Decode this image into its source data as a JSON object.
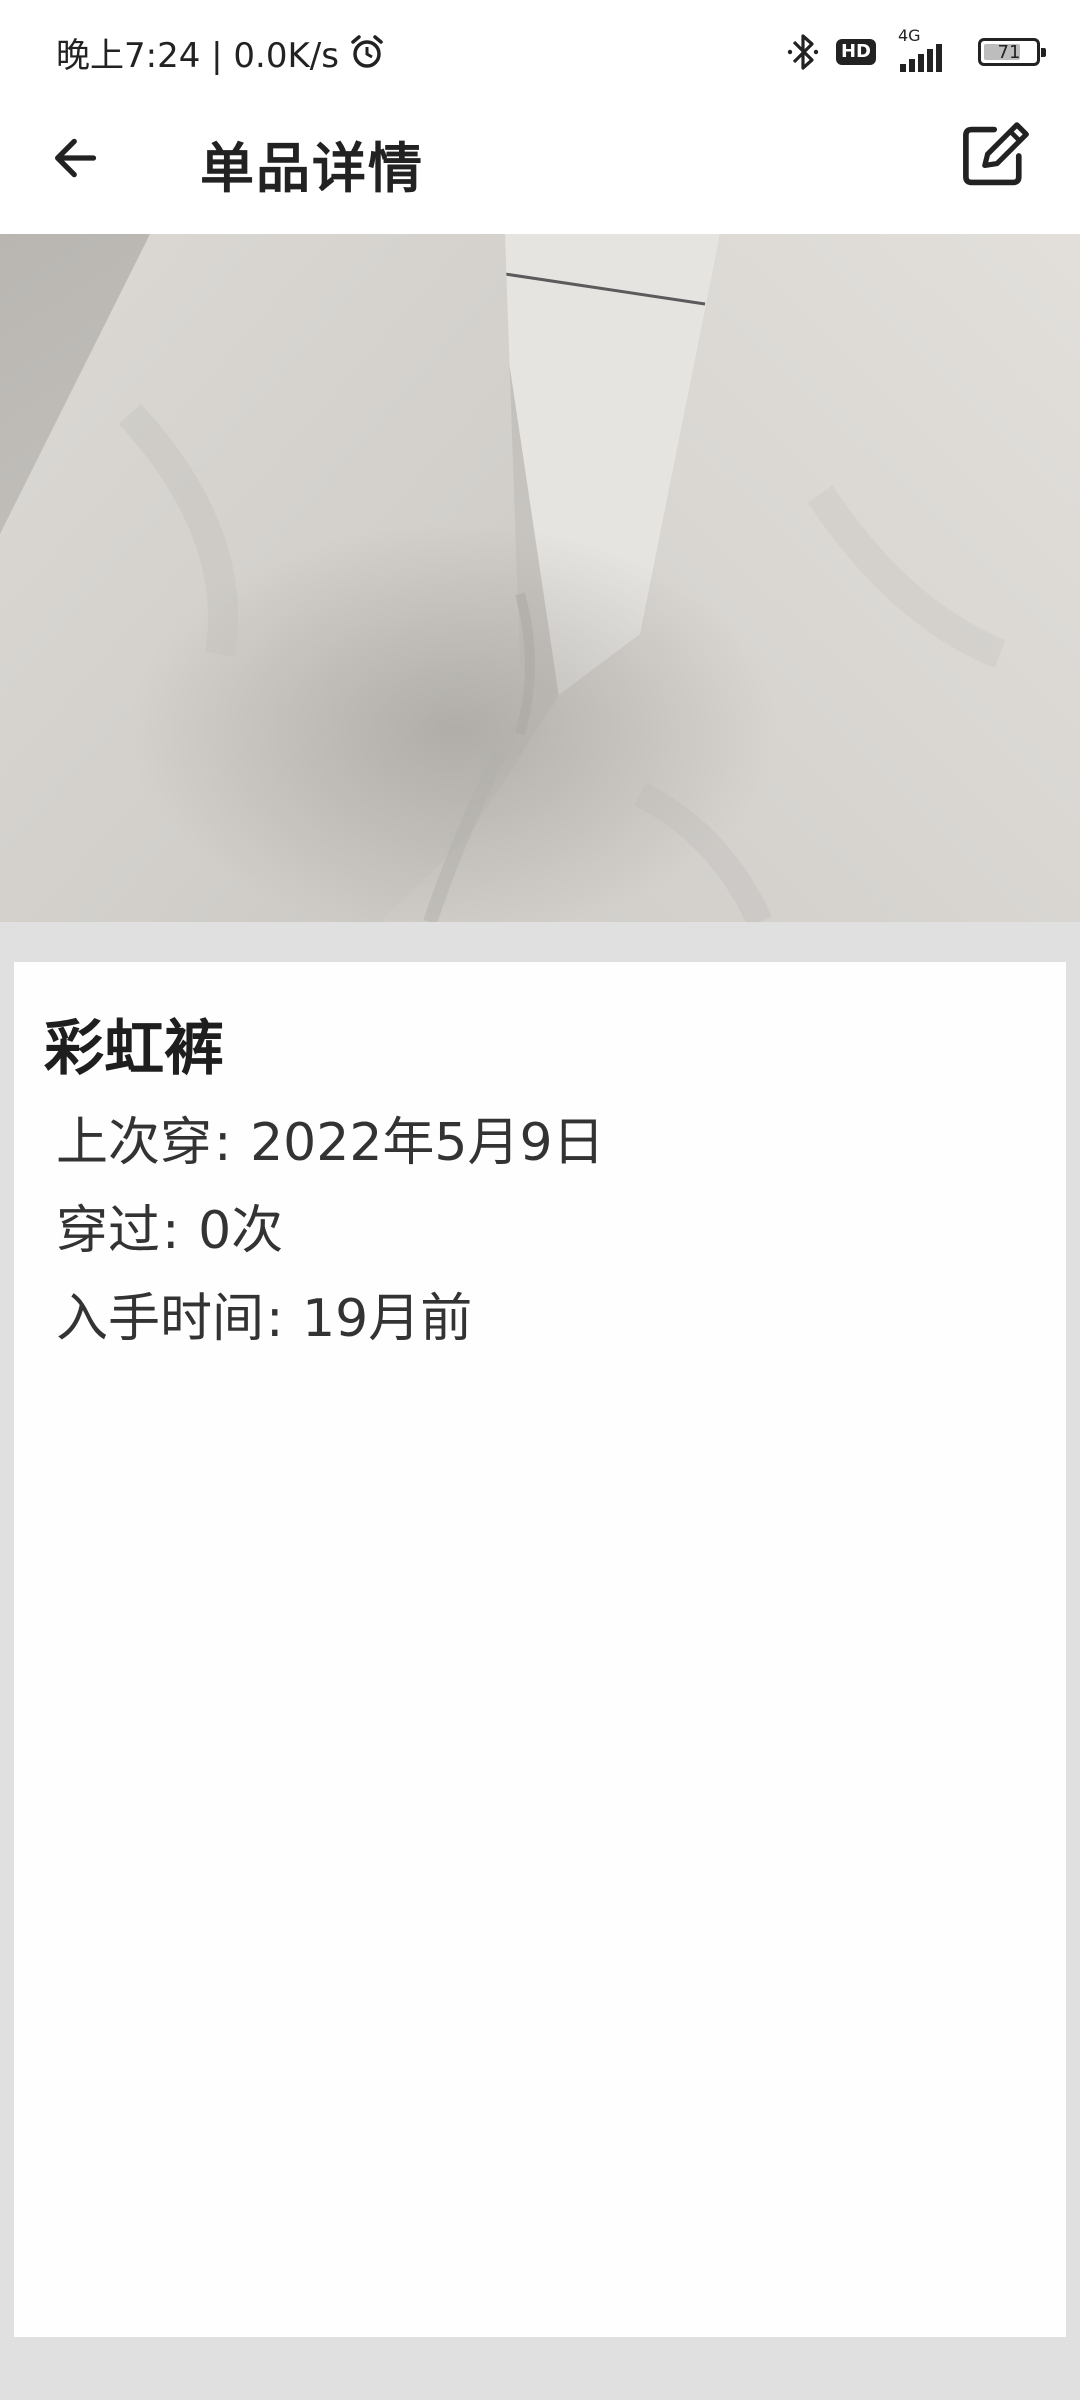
{
  "status_bar": {
    "time_speed": "晚上7:24 | 0.0K/s",
    "hd": "HD",
    "network_type": "4G",
    "battery_level": 71,
    "battery_text": "71"
  },
  "app_bar": {
    "title": "单品详情"
  },
  "item": {
    "name": "彩虹裤",
    "last_worn_label": "上次穿",
    "last_worn_value": "2022年5月9日",
    "times_worn_label": "穿过",
    "times_worn_value": "0次",
    "acquired_label": "入手时间",
    "acquired_value": "19月前"
  },
  "icons": {
    "back": "arrow-left",
    "edit": "edit-square-pencil",
    "alarm": "alarm-clock",
    "bluetooth": "bluetooth"
  },
  "colors": {
    "background": "#e0e0e0",
    "card": "#fefefe",
    "text": "#222222"
  }
}
